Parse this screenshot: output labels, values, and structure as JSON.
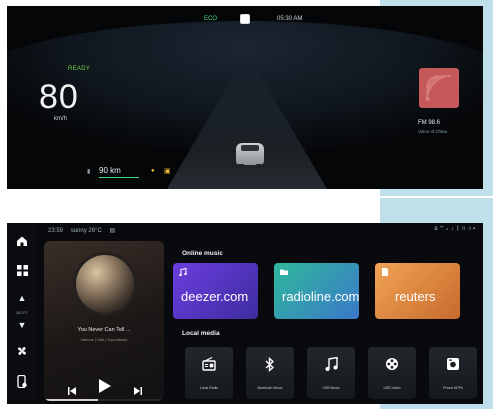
{
  "cluster": {
    "mode": "ECO",
    "time": "05:30 AM",
    "status": "READY",
    "speed": "80",
    "speed_unit": "km/h",
    "range_value": "90 km",
    "radio": {
      "frequency": "FM 98.6",
      "station": "Voice of China",
      "art_color": "#c55858"
    }
  },
  "infotainment": {
    "status_time": "23:59",
    "weather": "sunny 26°C",
    "sidebar": {
      "temperature_label": "26.5°C"
    },
    "now_playing": {
      "title": "You Never Can Tell ...",
      "artist": "Various | Hall | Soundtrack",
      "progress": 0.45
    },
    "online_music": {
      "title": "Online music",
      "tiles": [
        {
          "label": "deezer.com",
          "color": "#6b3ee0"
        },
        {
          "label": "radioline.com",
          "color": "#2fb89c"
        },
        {
          "label": "reuters",
          "color": "#f0a454"
        }
      ]
    },
    "local_media": {
      "title": "Local media",
      "items": [
        {
          "label": "Local Radio",
          "icon": "radio-icon"
        },
        {
          "label": "Bluetooth Music",
          "icon": "bluetooth-icon"
        },
        {
          "label": "USB Music",
          "icon": "music-note-icon"
        },
        {
          "label": "USB Video",
          "icon": "film-reel-icon"
        },
        {
          "label": "Phone APPs",
          "icon": "phone-app-icon"
        }
      ]
    }
  }
}
